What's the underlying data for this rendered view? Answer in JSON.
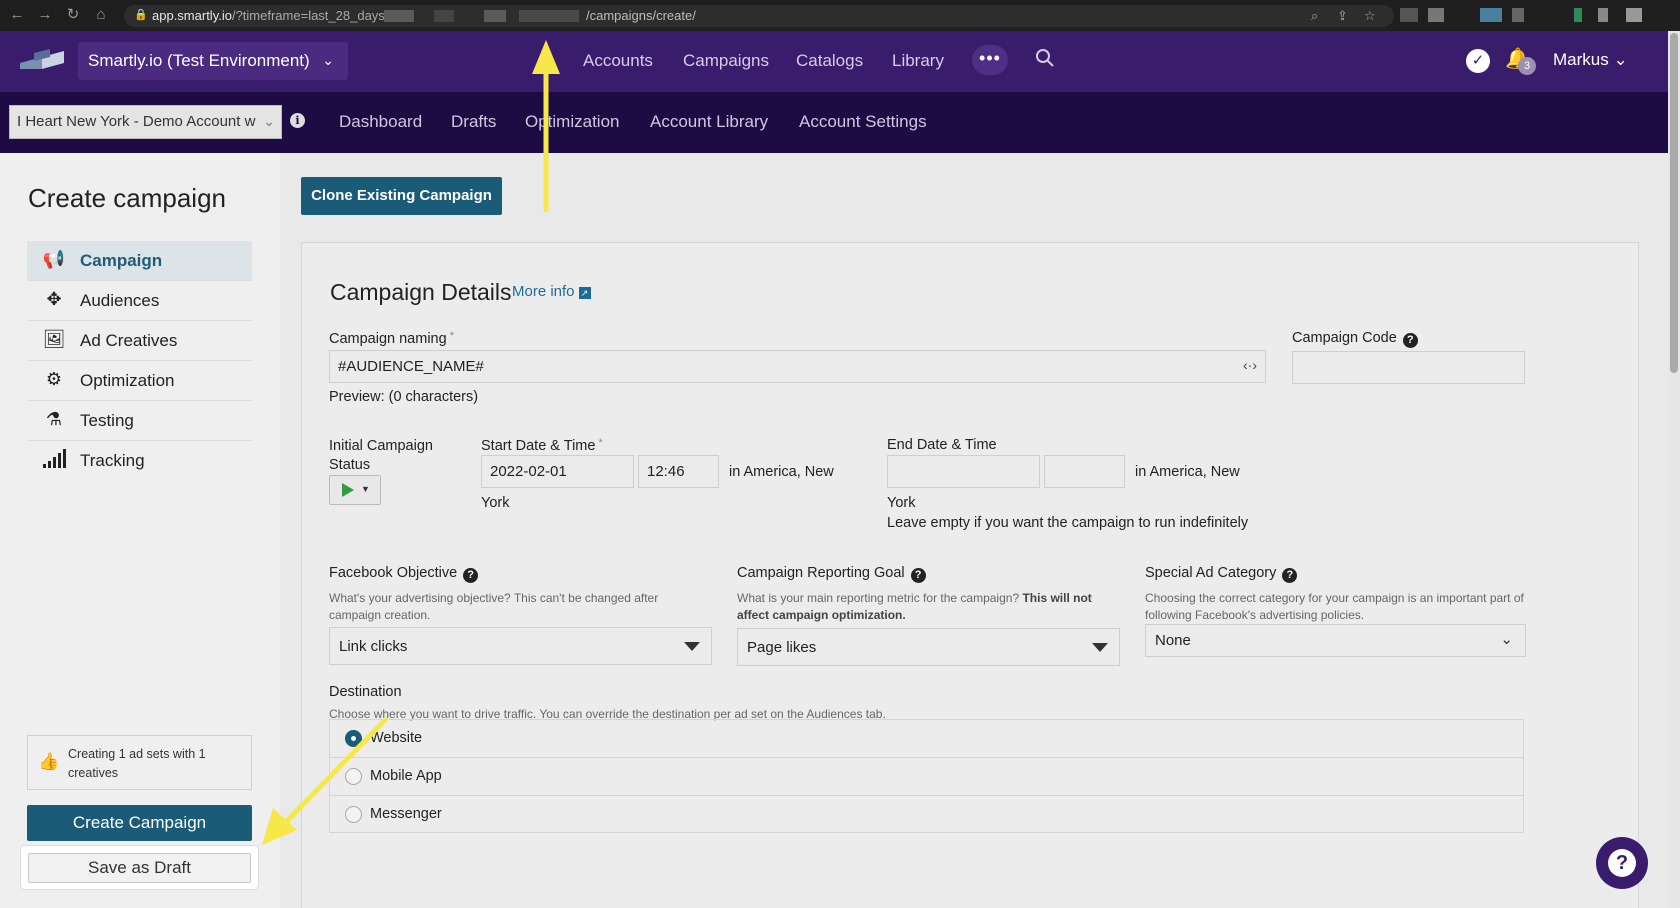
{
  "browser": {
    "url_host": "app.smartly.io",
    "url_query": "/?timeframe=last_28_days#/",
    "url_path": "/campaigns/create/"
  },
  "topnav": {
    "environment": "Smartly.io (Test Environment)",
    "links": [
      "Accounts",
      "Campaigns",
      "Catalogs",
      "Library"
    ],
    "more": "•••",
    "notification_count": "3",
    "user": "Markus"
  },
  "subnav": {
    "account": "I Heart New York - Demo Account w",
    "links": [
      "Dashboard",
      "Drafts",
      "Optimization",
      "Account Library",
      "Account Settings"
    ]
  },
  "sidebar": {
    "title": "Create campaign",
    "items": [
      {
        "label": "Campaign",
        "icon": "megaphone-icon"
      },
      {
        "label": "Audiences",
        "icon": "crosshair-icon"
      },
      {
        "label": "Ad Creatives",
        "icon": "image-icon"
      },
      {
        "label": "Optimization",
        "icon": "gears-icon"
      },
      {
        "label": "Testing",
        "icon": "flask-icon"
      },
      {
        "label": "Tracking",
        "icon": "signal-bars-icon"
      }
    ],
    "summary": "Creating 1 ad sets with 1 creatives",
    "create_button": "Create Campaign",
    "draft_button": "Save as Draft"
  },
  "main": {
    "clone_button": "Clone Existing Campaign",
    "section_title": "Campaign Details",
    "more_info": "More info",
    "naming_label": "Campaign naming",
    "naming_value": "#AUDIENCE_NAME#",
    "naming_preview": "Preview: (0 characters)",
    "code_label": "Campaign Code",
    "code_value": "",
    "status_label": "Initial Campaign Status",
    "start_label": "Start Date & Time",
    "start_date": "2022-02-01",
    "start_time": "12:46",
    "start_tz_1": "in America, New",
    "start_tz_2": "York",
    "end_label": "End Date & Time",
    "end_date": "",
    "end_time": "",
    "end_tz_1": "in America, New",
    "end_tz_2": "York",
    "end_hint": "Leave empty if you want the campaign to run indefinitely",
    "objective_label": "Facebook Objective",
    "objective_hint": "What's your advertising objective? This can't be changed after campaign creation.",
    "objective_value": "Link clicks",
    "goal_label": "Campaign Reporting Goal",
    "goal_hint": "What is your main reporting metric for the campaign?",
    "goal_hint_bold": "This will not affect campaign optimization.",
    "goal_value": "Page likes",
    "special_label": "Special Ad Category",
    "special_hint": "Choosing the correct category for your campaign is an important part of following Facebook's advertising policies.",
    "special_value": "None",
    "destination_label": "Destination",
    "destination_hint": "Choose where you want to drive traffic. You can override the destination per ad set on the Audiences tab.",
    "destinations": [
      {
        "label": "Website",
        "selected": true
      },
      {
        "label": "Mobile App",
        "selected": false
      },
      {
        "label": "Messenger",
        "selected": false
      }
    ]
  },
  "colors": {
    "topnav": "#3a1c6c",
    "subnav": "#1d0c44",
    "primary_button": "#1a5b78",
    "annotation_arrow": "#f7e84a"
  }
}
